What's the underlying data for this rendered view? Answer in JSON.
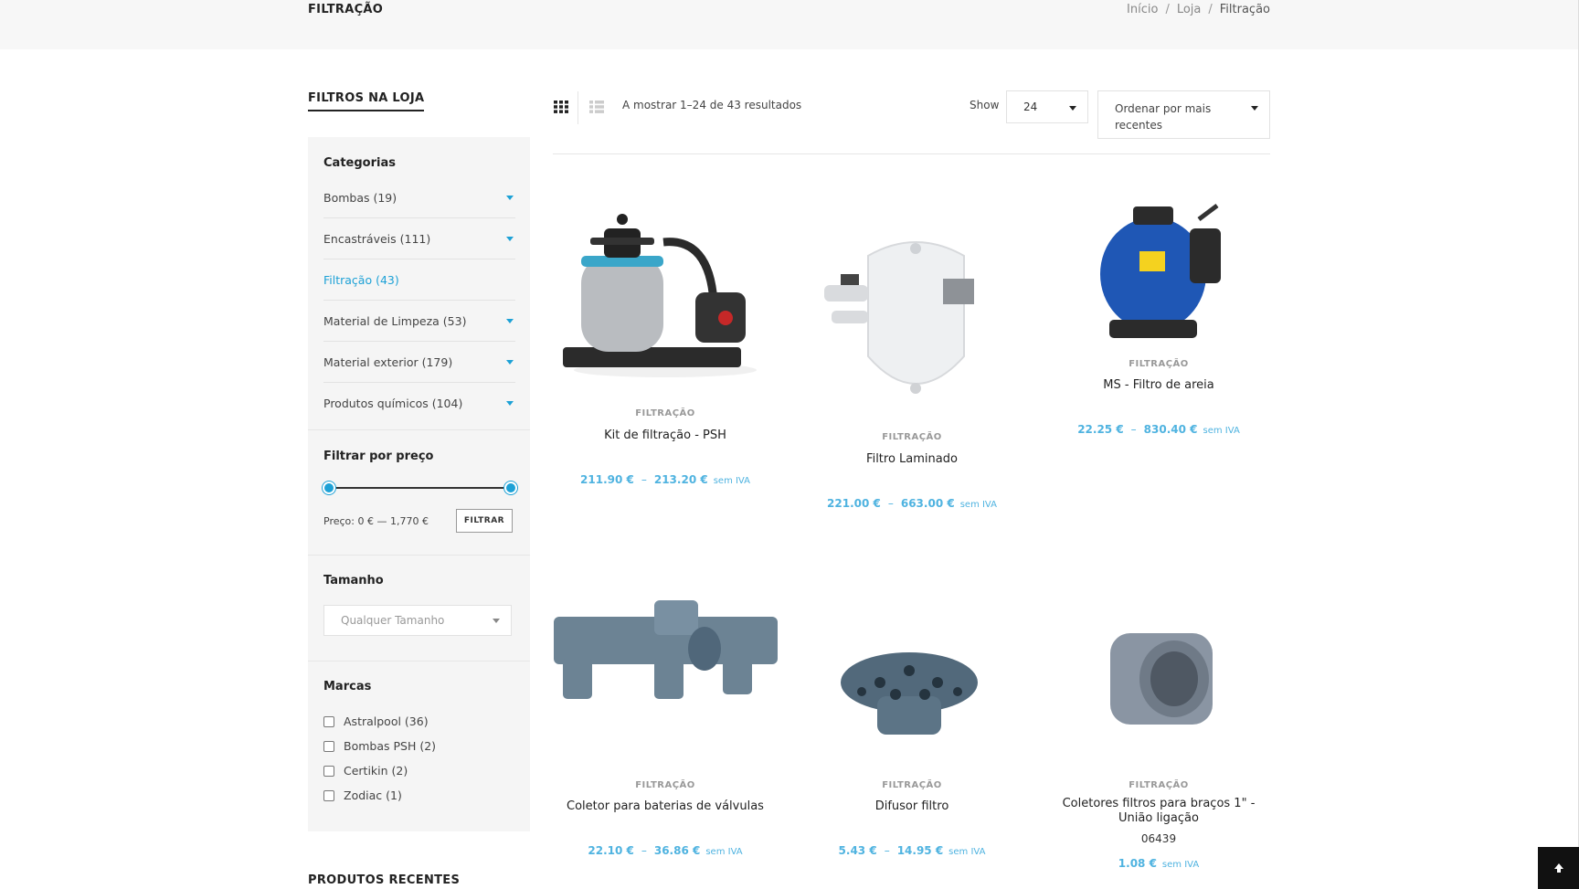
{
  "header": {
    "title": "FILTRAÇÃO",
    "breadcrumb": [
      "Início",
      "Loja",
      "Filtração"
    ]
  },
  "sidebar": {
    "heading": "FILTROS NA LOJA",
    "categories_title": "Categorias",
    "categories": [
      {
        "label": "Bombas (19)",
        "active": false,
        "expandable": true
      },
      {
        "label": "Encastráveis (111)",
        "active": false,
        "expandable": true
      },
      {
        "label": "Filtração (43)",
        "active": true,
        "expandable": false
      },
      {
        "label": "Material de Limpeza (53)",
        "active": false,
        "expandable": true
      },
      {
        "label": "Material exterior (179)",
        "active": false,
        "expandable": true
      },
      {
        "label": "Produtos químicos (104)",
        "active": false,
        "expandable": true
      }
    ],
    "price_title": "Filtrar por preço",
    "price_label": "Preço: 0 € — 1,770 €",
    "price_range": {
      "min": 0,
      "max": 1770
    },
    "filter_button": "FILTRAR",
    "size_title": "Tamanho",
    "size_placeholder": "Qualquer Tamanho",
    "brands_title": "Marcas",
    "brands": [
      {
        "label": "Astralpool (36)"
      },
      {
        "label": "Bombas PSH (2)"
      },
      {
        "label": "Certikin (2)"
      },
      {
        "label": "Zodiac (1)"
      }
    ],
    "recent_heading": "PRODUTOS RECENTES"
  },
  "toolbar": {
    "result_count": "A mostrar 1–24 de 43 resultados",
    "show_label": "Show",
    "show_value": "24",
    "order_value": "Ordenar por mais recentes"
  },
  "products": [
    {
      "category": "FILTRAÇÃO",
      "name": "Kit de filtração - PSH",
      "price_min": "211.90 €",
      "price_max": "213.20 €",
      "tax": "sem IVA"
    },
    {
      "category": "FILTRAÇÃO",
      "name": "Filtro Laminado",
      "price_min": "221.00 €",
      "price_max": "663.00 €",
      "tax": "sem IVA"
    },
    {
      "category": "FILTRAÇÃO",
      "name": "MS - Filtro de areia",
      "price_min": "22.25 €",
      "price_max": "830.40 €",
      "tax": "sem IVA"
    },
    {
      "category": "FILTRAÇÃO",
      "name": "Coletor para baterias de válvulas",
      "price_min": "22.10 €",
      "price_max": "36.86 €",
      "tax": "sem IVA"
    },
    {
      "category": "FILTRAÇÃO",
      "name": "Difusor filtro",
      "price_min": "5.43 €",
      "price_max": "14.95 €",
      "tax": "sem IVA"
    },
    {
      "category": "FILTRAÇÃO",
      "name": "Coletores filtros para braços 1\" - União ligação",
      "sku": "06439",
      "price": "1.08 €",
      "tax": "sem IVA"
    }
  ],
  "colors": {
    "accent": "#1da1d6",
    "price": "#4fb3e0"
  }
}
